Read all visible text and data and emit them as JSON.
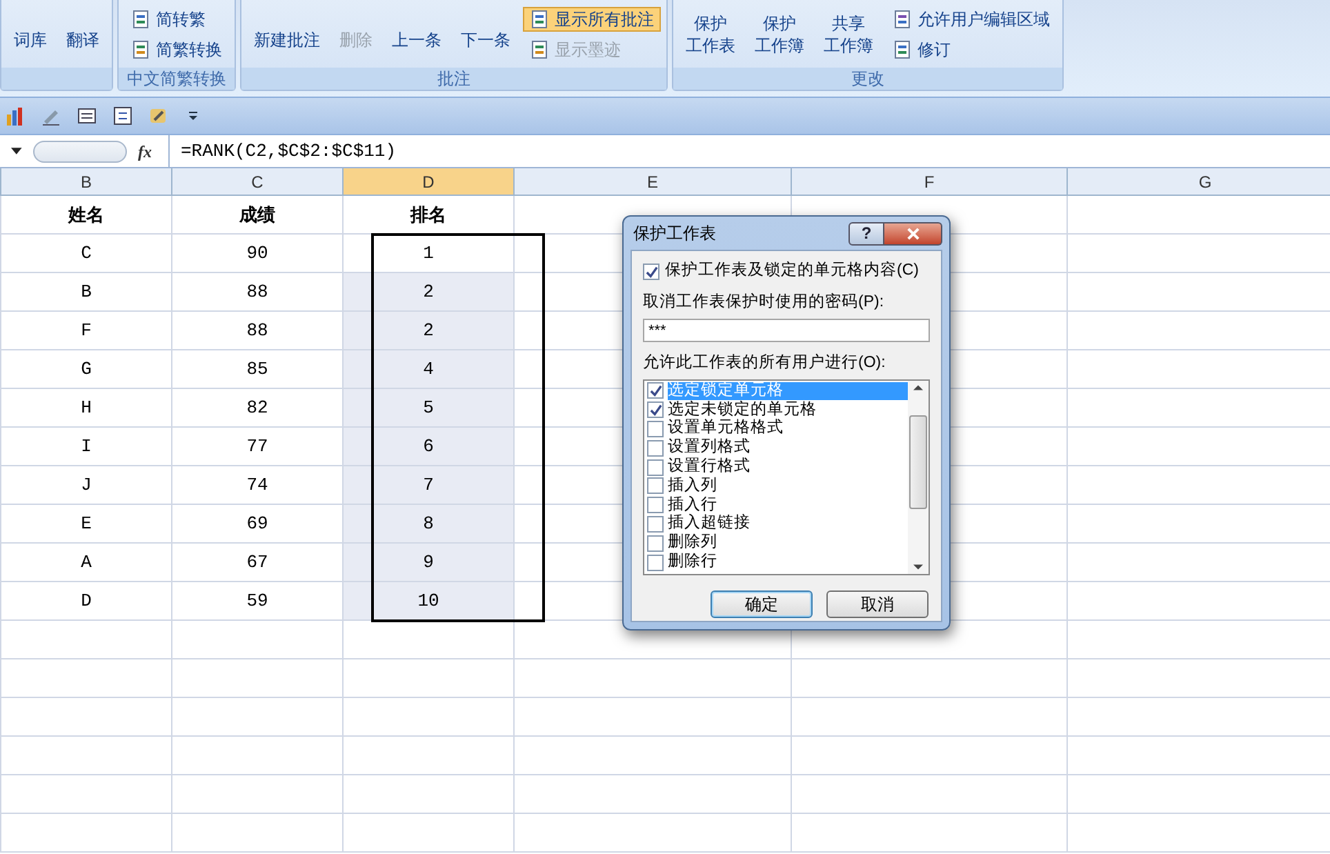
{
  "ribbon": {
    "groups": [
      {
        "items": [
          {
            "kind": "small",
            "label": "词库",
            "disabled": false,
            "selected": false
          },
          {
            "kind": "small",
            "label": "翻译",
            "disabled": false,
            "selected": false
          }
        ]
      },
      {
        "label": "中文简繁转换",
        "items": [
          {
            "kind": "row",
            "label": "简转繁",
            "disabled": false,
            "selected": false
          },
          {
            "kind": "row",
            "label": "简繁转换",
            "disabled": false,
            "selected": false
          }
        ]
      },
      {
        "label": "批注",
        "items": [
          {
            "kind": "small",
            "label": "新建批注",
            "disabled": false,
            "selected": false
          },
          {
            "kind": "small",
            "label": "删除",
            "disabled": true,
            "selected": false
          },
          {
            "kind": "small",
            "label": "上一条",
            "disabled": false,
            "selected": false
          },
          {
            "kind": "small",
            "label": "下一条",
            "disabled": false,
            "selected": false
          },
          {
            "kind": "row",
            "label": "显示所有批注",
            "disabled": false,
            "selected": true
          },
          {
            "kind": "row",
            "label": "显示墨迹",
            "disabled": true,
            "selected": false
          }
        ]
      },
      {
        "label": "更改",
        "items": [
          {
            "kind": "big",
            "lines": [
              "保护",
              "工作表"
            ],
            "disabled": false,
            "selected": false
          },
          {
            "kind": "big",
            "lines": [
              "保护",
              "工作簿"
            ],
            "disabled": false,
            "selected": false
          },
          {
            "kind": "big",
            "lines": [
              "共享",
              "工作簿"
            ],
            "disabled": false,
            "selected": false
          },
          {
            "kind": "row",
            "label": "允许用户编辑区域",
            "disabled": false,
            "selected": false
          },
          {
            "kind": "row",
            "label": "修订",
            "disabled": false,
            "selected": false
          }
        ]
      }
    ]
  },
  "formula_bar": {
    "function_label": "fx",
    "formula": "=RANK(C2,$C$2:$C$11)"
  },
  "columns": [
    {
      "label": "B",
      "selected": false
    },
    {
      "label": "C",
      "selected": false
    },
    {
      "label": "D",
      "selected": true
    },
    {
      "label": "E",
      "selected": false
    },
    {
      "label": "F",
      "selected": false
    },
    {
      "label": "G",
      "selected": false
    }
  ],
  "header_row": [
    "姓名",
    "成绩",
    "排名"
  ],
  "rows": [
    {
      "name": "C",
      "score": "90",
      "rank": "1"
    },
    {
      "name": "B",
      "score": "88",
      "rank": "2"
    },
    {
      "name": "F",
      "score": "88",
      "rank": "2"
    },
    {
      "name": "G",
      "score": "85",
      "rank": "4"
    },
    {
      "name": "H",
      "score": "82",
      "rank": "5"
    },
    {
      "name": "I",
      "score": "77",
      "rank": "6"
    },
    {
      "name": "J",
      "score": "74",
      "rank": "7"
    },
    {
      "name": "E",
      "score": "69",
      "rank": "8"
    },
    {
      "name": "A",
      "score": "67",
      "rank": "9"
    },
    {
      "name": "D",
      "score": "59",
      "rank": "10"
    }
  ],
  "dialog": {
    "title": "保护工作表",
    "help": "?",
    "protect": {
      "label": "保护工作表及锁定的单元格内容(C)",
      "checked": true
    },
    "password_label": "取消工作表保护时使用的密码(P):",
    "password": "***",
    "allow_label": "允许此工作表的所有用户进行(O):",
    "options": [
      {
        "label": "选定锁定单元格",
        "checked": true,
        "selected": true
      },
      {
        "label": "选定未锁定的单元格",
        "checked": true,
        "selected": false
      },
      {
        "label": "设置单元格格式",
        "checked": false,
        "selected": false
      },
      {
        "label": "设置列格式",
        "checked": false,
        "selected": false
      },
      {
        "label": "设置行格式",
        "checked": false,
        "selected": false
      },
      {
        "label": "插入列",
        "checked": false,
        "selected": false
      },
      {
        "label": "插入行",
        "checked": false,
        "selected": false
      },
      {
        "label": "插入超链接",
        "checked": false,
        "selected": false
      },
      {
        "label": "删除列",
        "checked": false,
        "selected": false
      },
      {
        "label": "删除行",
        "checked": false,
        "selected": false
      }
    ],
    "buttons": [
      "确定",
      "取消"
    ]
  }
}
